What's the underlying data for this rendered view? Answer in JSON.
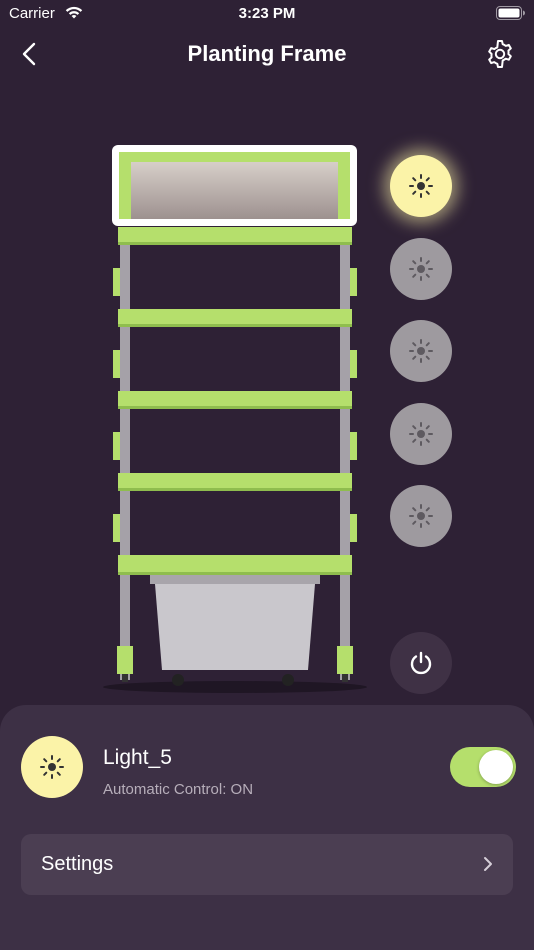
{
  "status_bar": {
    "carrier": "Carrier",
    "time": "3:23 PM"
  },
  "nav": {
    "title": "Planting Frame"
  },
  "lights": [
    {
      "id": "light-1",
      "active": true
    },
    {
      "id": "light-2",
      "active": false
    },
    {
      "id": "light-3",
      "active": false
    },
    {
      "id": "light-4",
      "active": false
    },
    {
      "id": "light-5",
      "active": false
    }
  ],
  "detail": {
    "name": "Light_5",
    "subtitle": "Automatic Control: ON",
    "toggle_on": true,
    "settings_label": "Settings"
  },
  "colors": {
    "background": "#2e2135",
    "panel": "#3d3045",
    "accent_green": "#b5df6c",
    "light_on": "#fbf3a8",
    "light_off": "#9e9a9f"
  }
}
